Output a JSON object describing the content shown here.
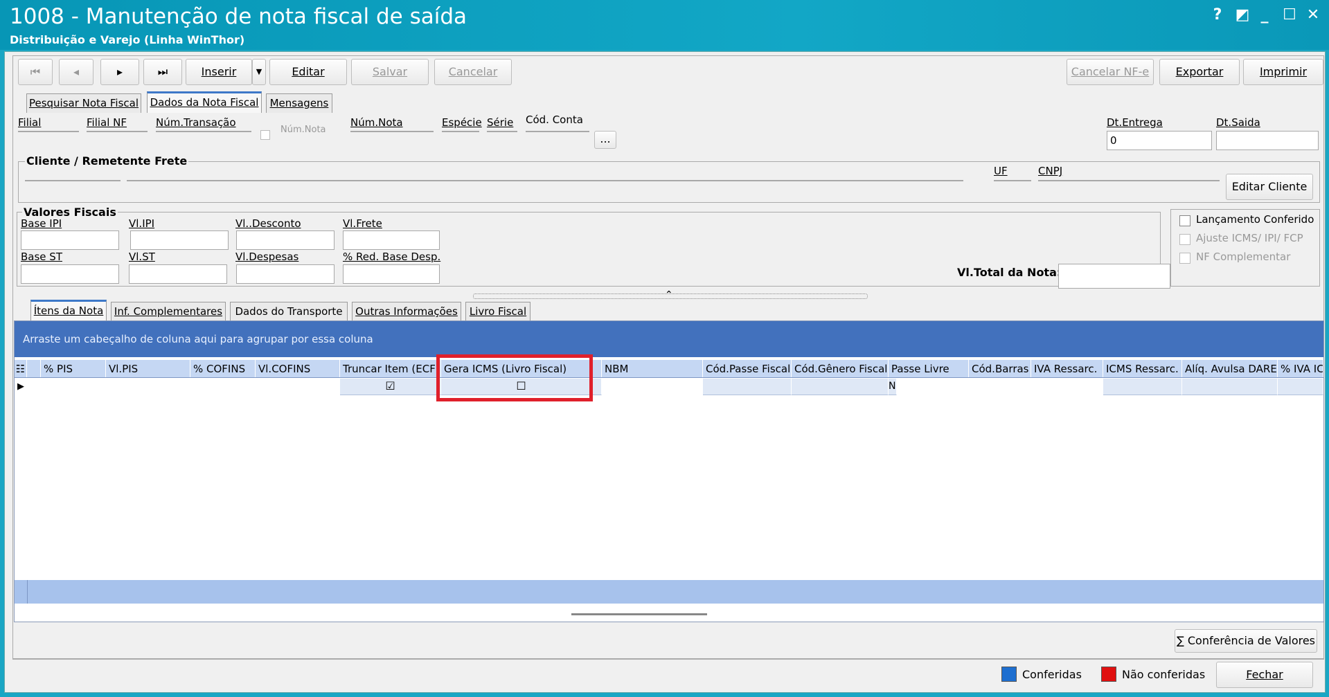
{
  "window": {
    "title": "1008 - Manutenção de nota fiscal de saída",
    "subtitle": "Distribuição e Varejo (Linha WinThor)",
    "controls": [
      "?",
      "◩",
      "_",
      "☐",
      "✕"
    ]
  },
  "toolbar": {
    "first": "⏮",
    "prev": "◂",
    "next": "▸",
    "last": "⏭",
    "insert": "Inserir",
    "dropdown": "▼",
    "edit": "Editar",
    "save": "Salvar",
    "cancel": "Cancelar",
    "cancel_nfe": "Cancelar NF-e",
    "export": "Exportar",
    "print": "Imprimir"
  },
  "tabs_top": [
    "Pesquisar Nota Fiscal",
    "Dados da Nota Fiscal",
    "Mensagens"
  ],
  "header_fields": {
    "filial": "Filial",
    "filial_nf": "Filial NF",
    "num_transacao": "Núm.Transação",
    "num_nota_check": "Núm.Nota",
    "num_nota": "Núm.Nota",
    "especie": "Espécie",
    "serie": "Série",
    "cod_conta": "Cód. Conta",
    "ellipsis": "...",
    "dt_entrega": "Dt.Entrega",
    "dt_entrega_value": "0",
    "dt_saida": "Dt.Saida"
  },
  "cliente": {
    "title": "Cliente / Remetente Frete",
    "uf": "UF",
    "cnpj": "CNPJ",
    "edit_button": "Editar Cliente"
  },
  "valores": {
    "title": "Valores Fiscais",
    "base_ipi": "Base IPI",
    "vl_ipi": "Vl.IPI",
    "vl_desconto": "Vl..Desconto",
    "vl_frete": "Vl.Frete",
    "base_st": "Base ST",
    "vl_st": "Vl.ST",
    "vl_despesas": "Vl.Despesas",
    "red_base": "% Red. Base Desp.",
    "vl_total": "Vl.Total da Nota:"
  },
  "checks": {
    "lancamento": "Lançamento Conferido",
    "ajuste": "Ajuste ICMS/ IPI/ FCP",
    "nf_complementar": "NF Complementar"
  },
  "tabs_bottom": [
    "Ítens da Nota",
    "Inf. Complementares",
    "Dados do Transporte",
    "Outras Informações",
    "Livro Fiscal"
  ],
  "grid": {
    "group_hint": "Arraste um cabeçalho de coluna aqui para agrupar por essa coluna",
    "columns": [
      "% PIS",
      "Vl.PIS",
      "% COFINS",
      "Vl.COFINS",
      "Truncar Item (ECF)",
      "Gera ICMS (Livro Fiscal)",
      "NBM",
      "Cód.Passe Fiscal",
      "Cód.Gênero Fiscal",
      "Passe Livre",
      "Cód.Barras",
      "IVA Ressarc.",
      "ICMS Ressarc.",
      "Alíq. Avulsa DARE",
      "% IVA ICMS"
    ],
    "row": {
      "truncar": "☑",
      "gera": "☐",
      "passe_livre": "N"
    }
  },
  "bottom": {
    "conferencia": "∑ Conferência de Valores",
    "conferidas": "Conferidas",
    "nao_conferidas": "Não conferidas",
    "fechar": "Fechar",
    "color_conferidas": "#1e6fd0",
    "color_nao": "#e01010"
  }
}
